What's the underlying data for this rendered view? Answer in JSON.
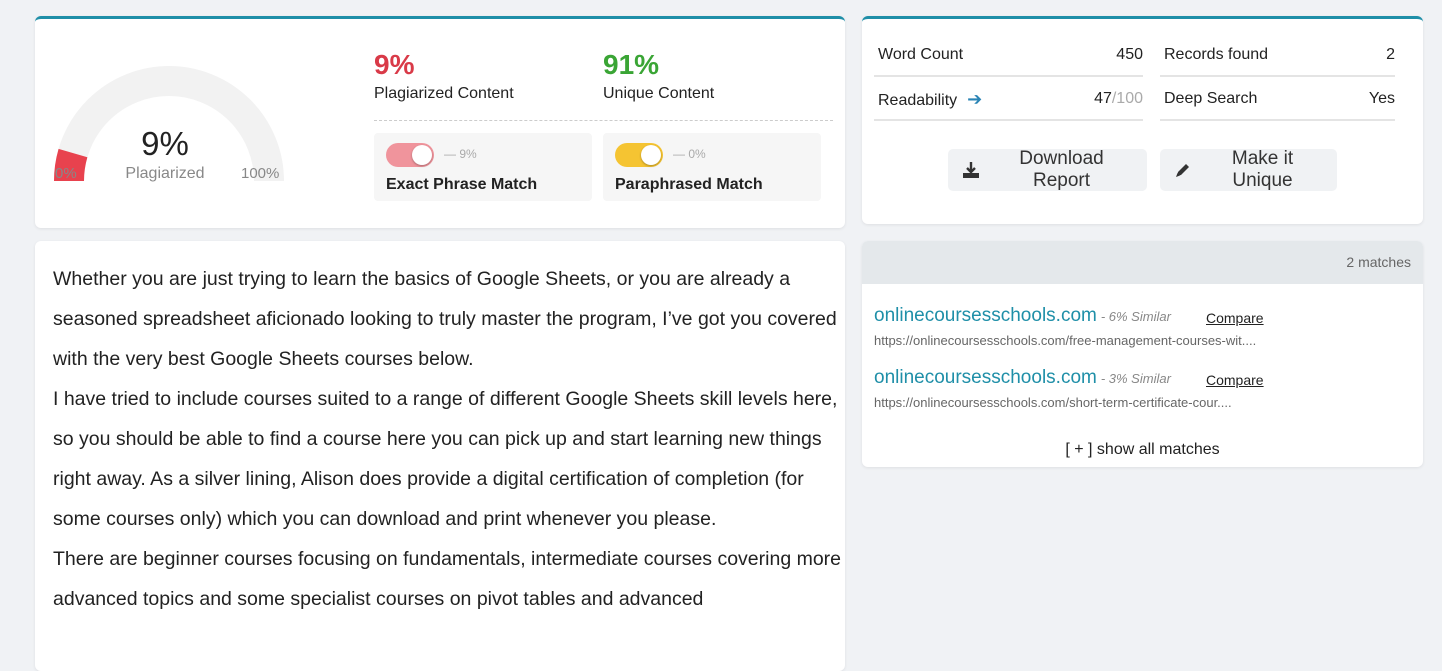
{
  "summary": {
    "gauge_value": "9%",
    "gauge_caption": "Plagiarized",
    "gauge_min": "0%",
    "gauge_max": "100%",
    "gauge_fraction": 0.09,
    "plagiarized_pct": "9%",
    "plagiarized_label": "Plagiarized Content",
    "unique_pct": "91%",
    "unique_label": "Unique Content",
    "exact": {
      "pct": "— 9%",
      "label": "Exact Phrase Match"
    },
    "paraphrased": {
      "pct": "— 0%",
      "label": "Paraphrased Match"
    }
  },
  "stats": {
    "word_count_label": "Word Count",
    "word_count": "450",
    "records_label": "Records found",
    "records": "2",
    "readability_label": "Readability",
    "readability_value": "47",
    "readability_max": "/100",
    "deep_search_label": "Deep Search",
    "deep_search": "Yes",
    "download_label": "Download Report",
    "unique_button_label": "Make it Unique"
  },
  "content": {
    "paragraphs": [
      "Whether you are just trying to learn the basics of Google Sheets, or you are already a seasoned spreadsheet aficionado looking to truly master the program, I’ve got you covered with the very best Google Sheets courses below.",
      "I have tried to include courses suited to a range of different Google Sheets skill levels here, so you should be able to find a course here you can pick up and start learning new things right away.  As a silver lining, Alison does provide a digital certification of completion (for some courses only) which you can download and print whenever you please.",
      "There are beginner courses focusing on fundamentals, intermediate courses covering more advanced topics and some specialist courses on pivot tables and advanced"
    ]
  },
  "matches": {
    "count_label": "2 matches",
    "items": [
      {
        "domain": "onlinecoursesschools.com",
        "similar": "- 6% Similar",
        "compare": "Compare",
        "url": "https://onlinecoursesschools.com/free-management-courses-wit...."
      },
      {
        "domain": "onlinecoursesschools.com",
        "similar": "- 3% Similar",
        "compare": "Compare",
        "url": "https://onlinecoursesschools.com/short-term-certificate-cour...."
      }
    ],
    "show_all_label": "[ + ] show all matches"
  },
  "colors": {
    "accent": "#1f8fa8",
    "plagiarized": "#d93a48",
    "unique": "#3aa535",
    "exact_toggle": "#f0949c",
    "paraphrase_toggle": "#f5c432"
  },
  "icons": {
    "readability": "arrow-right-icon",
    "download": "download-icon",
    "unique": "pencil-icon"
  }
}
